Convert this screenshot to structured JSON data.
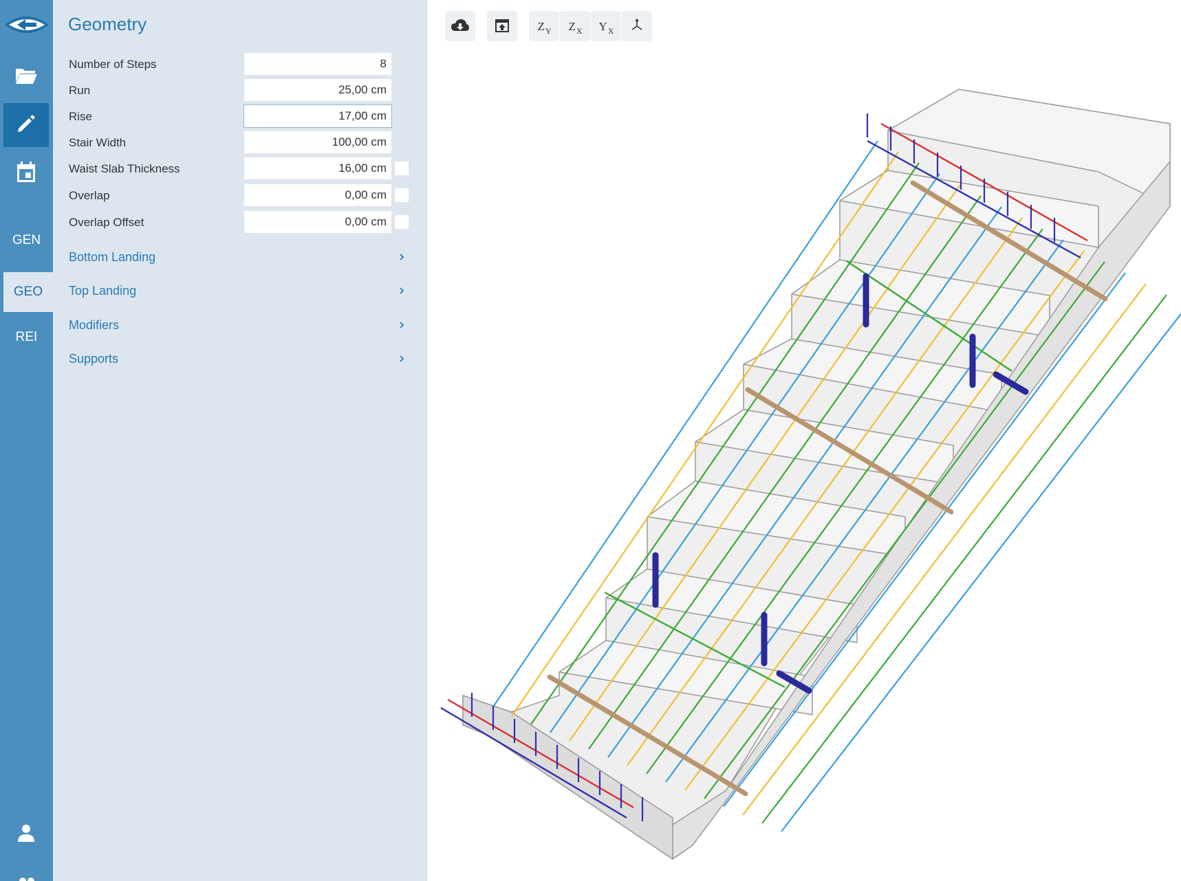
{
  "rail": {
    "gen_label": "GEN",
    "geo_label": "GEO",
    "rei_label": "REI"
  },
  "panel": {
    "title": "Geometry",
    "fields": [
      {
        "label": "Number of Steps",
        "value": "8"
      },
      {
        "label": "Run",
        "value": "25,00 cm"
      },
      {
        "label": "Rise",
        "value": "17,00 cm"
      },
      {
        "label": "Stair Width",
        "value": "100,00 cm"
      },
      {
        "label": "Waist Slab Thickness",
        "value": "16,00 cm"
      },
      {
        "label": "Overlap",
        "value": "0,00 cm"
      },
      {
        "label": "Overlap Offset",
        "value": "0,00 cm"
      }
    ],
    "sections": [
      {
        "label": "Bottom Landing"
      },
      {
        "label": "Top Landing"
      },
      {
        "label": "Modifiers"
      },
      {
        "label": "Supports"
      }
    ]
  },
  "toolbar": {
    "view_zy": {
      "main": "Z",
      "sub": "Y"
    },
    "view_zx": {
      "main": "Z",
      "sub": "X"
    },
    "view_yx": {
      "main": "Y",
      "sub": "X"
    }
  },
  "icons": {
    "logo": "eye-logo-icon",
    "open": "folder-open-icon",
    "edit": "pencil-icon",
    "calendar": "calendar-icon",
    "user": "user-icon",
    "download": "cloud-download-icon",
    "export": "export-icon",
    "axis": "axis-3d-icon",
    "chevron": "chevron-right-icon"
  },
  "colors": {
    "rail": "#4a8fbe",
    "rail_active": "#1d6fa8",
    "panel": "#dde6ef",
    "accent": "#2a7ab4",
    "rebar_blue": "#3aa0dc",
    "rebar_yellow": "#f0c030",
    "rebar_green": "#3aaa35",
    "rebar_red": "#d83030",
    "rebar_navy": "#3030b0",
    "anchor": "#2a2a9a"
  }
}
